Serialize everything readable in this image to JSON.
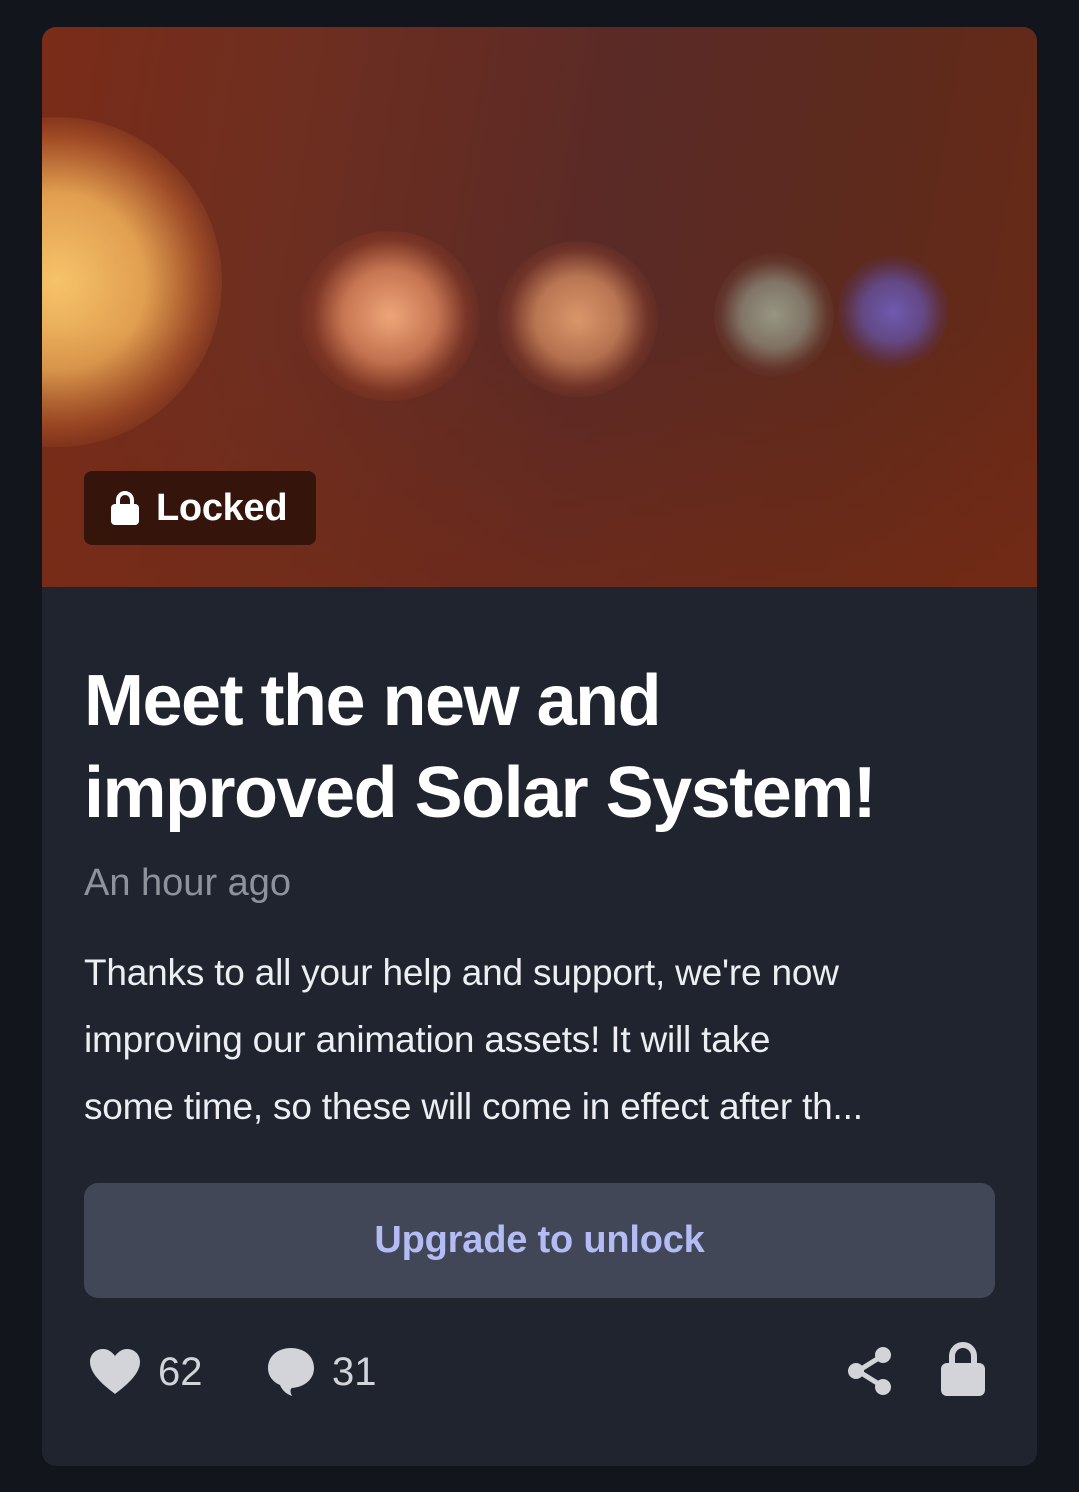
{
  "post": {
    "badge_label": "Locked",
    "title": "Meet the new and improved Solar System!",
    "timestamp": "An hour ago",
    "excerpt_lines": [
      "Thanks to all your help and support, we're now",
      "improving our animation assets! It will take",
      "some time, so these will come in effect after th..."
    ],
    "upgrade_label": "Upgrade to unlock",
    "likes": "62",
    "comments": "31"
  },
  "icons": {
    "badge": "lock-icon",
    "likes": "heart-icon",
    "comments": "comment-bubble-icon",
    "share": "share-icon",
    "lock_action": "lock-icon"
  },
  "colors": {
    "page_background": "#12151b",
    "card_background": "#20242f",
    "button_background": "#424757",
    "button_text": "#b3bcf4",
    "timestamp_text": "#8e929b",
    "badge_background": "#30120a"
  }
}
